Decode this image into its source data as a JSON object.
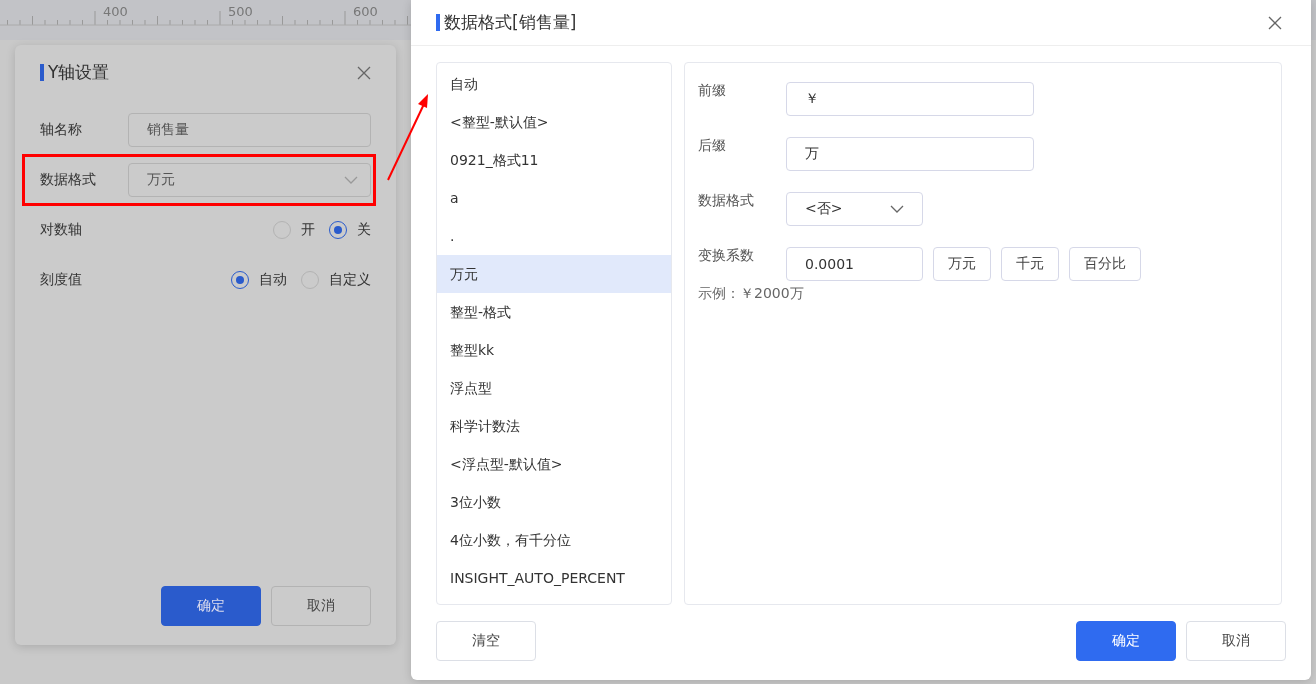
{
  "ruler": {
    "labels": [
      "400",
      "500",
      "600"
    ]
  },
  "axis_dialog": {
    "title": "Y轴设置",
    "fields": [
      {
        "kind": "text",
        "label": "轴名称",
        "value": "销售量",
        "highlighted": false
      },
      {
        "kind": "select",
        "label": "数据格式",
        "value": "万元",
        "highlighted": true
      },
      {
        "kind": "radio",
        "label": "对数轴",
        "highlighted": false,
        "options": [
          {
            "label": "开",
            "selected": false
          },
          {
            "label": "关",
            "selected": true
          }
        ]
      },
      {
        "kind": "radio",
        "label": "刻度值",
        "highlighted": false,
        "options": [
          {
            "label": "自动",
            "selected": true
          },
          {
            "label": "自定义",
            "selected": false
          }
        ]
      }
    ],
    "buttons": [
      {
        "label": "确定",
        "primary": true
      },
      {
        "label": "取消",
        "primary": false
      }
    ]
  },
  "format_dialog": {
    "title": "数据格式[销售量]",
    "formats": [
      {
        "label": "自动",
        "selected": false
      },
      {
        "label": "<整型-默认值>",
        "selected": false
      },
      {
        "label": "0921_格式11",
        "selected": false
      },
      {
        "label": "a",
        "selected": false
      },
      {
        "label": ".",
        "selected": false
      },
      {
        "label": "万元",
        "selected": true
      },
      {
        "label": "整型-格式",
        "selected": false
      },
      {
        "label": "整型kk",
        "selected": false
      },
      {
        "label": "浮点型",
        "selected": false
      },
      {
        "label": "科学计数法",
        "selected": false
      },
      {
        "label": "<浮点型-默认值>",
        "selected": false
      },
      {
        "label": "3位小数",
        "selected": false
      },
      {
        "label": "4位小数，有千分位",
        "selected": false
      },
      {
        "label": "INSIGHT_AUTO_PERCENT",
        "selected": false
      }
    ],
    "fields": [
      {
        "kind": "text",
        "label": "前缀",
        "value": "￥"
      },
      {
        "kind": "text",
        "label": "后缀",
        "value": "万"
      },
      {
        "kind": "select",
        "label": "数据格式",
        "value": "<否>"
      },
      {
        "kind": "factor",
        "label": "变换系数",
        "value": "0.0001",
        "presets": [
          "万元",
          "千元",
          "百分比"
        ]
      }
    ],
    "example": "示例：￥2000万",
    "left_buttons": [
      {
        "label": "清空",
        "primary": false
      }
    ],
    "right_buttons": [
      {
        "label": "确定",
        "primary": true
      },
      {
        "label": "取消",
        "primary": false
      }
    ]
  }
}
